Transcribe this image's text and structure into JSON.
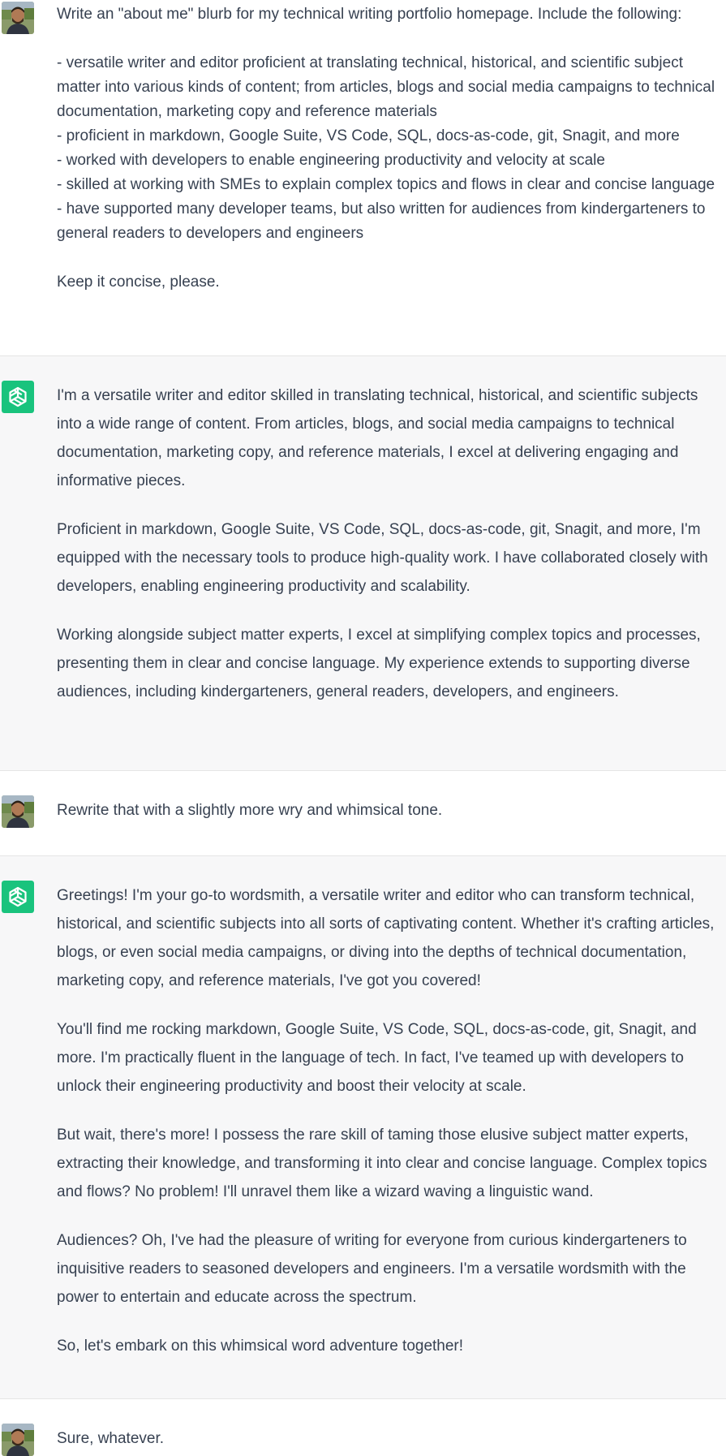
{
  "conversation": {
    "turns": [
      {
        "role": "user",
        "avatar_icon": "user-avatar",
        "paragraphs": [
          "Write an \"about me\" blurb for my technical writing portfolio homepage. Include the following:",
          "- versatile writer and editor proficient at translating technical, historical, and scientific subject matter into various kinds of content; from articles, blogs and social media campaigns to technical documentation, marketing copy and reference materials\n- proficient in markdown, Google Suite, VS Code, SQL, docs-as-code, git, Snagit, and more\n- worked with developers to enable engineering productivity and velocity at scale\n- skilled at working with SMEs to explain complex topics and flows in clear and concise language\n- have supported many developer teams, but also written for audiences from kindergarteners to general readers to developers and engineers",
          "Keep it concise, please."
        ]
      },
      {
        "role": "assistant",
        "avatar_icon": "chatgpt-logo-icon",
        "paragraphs": [
          "I'm a versatile writer and editor skilled in translating technical, historical, and scientific subjects into a wide range of content. From articles, blogs, and social media campaigns to technical documentation, marketing copy, and reference materials, I excel at delivering engaging and informative pieces.",
          "Proficient in markdown, Google Suite, VS Code, SQL, docs-as-code, git, Snagit, and more, I'm equipped with the necessary tools to produce high-quality work. I have collaborated closely with developers, enabling engineering productivity and scalability.",
          "Working alongside subject matter experts, I excel at simplifying complex topics and processes, presenting them in clear and concise language. My experience extends to supporting diverse audiences, including kindergarteners, general readers, developers, and engineers."
        ]
      },
      {
        "role": "user",
        "avatar_icon": "user-avatar",
        "paragraphs": [
          "Rewrite that with a slightly more wry and whimsical tone."
        ]
      },
      {
        "role": "assistant",
        "avatar_icon": "chatgpt-logo-icon",
        "paragraphs": [
          "Greetings! I'm your go-to wordsmith, a versatile writer and editor who can transform technical, historical, and scientific subjects into all sorts of captivating content. Whether it's crafting articles, blogs, or even social media campaigns, or diving into the depths of technical documentation, marketing copy, and reference materials, I've got you covered!",
          "You'll find me rocking markdown, Google Suite, VS Code, SQL, docs-as-code, git, Snagit, and more. I'm practically fluent in the language of tech. In fact, I've teamed up with developers to unlock their engineering productivity and boost their velocity at scale.",
          "But wait, there's more! I possess the rare skill of taming those elusive subject matter experts, extracting their knowledge, and transforming it into clear and concise language. Complex topics and flows? No problem! I'll unravel them like a wizard waving a linguistic wand.",
          "Audiences? Oh, I've had the pleasure of writing for everyone from curious kindergarteners to inquisitive readers to seasoned developers and engineers. I'm a versatile wordsmith with the power to entertain and educate across the spectrum.",
          "So, let's embark on this whimsical word adventure together!"
        ]
      },
      {
        "role": "user",
        "avatar_icon": "user-avatar",
        "paragraphs": [
          "Sure, whatever."
        ]
      }
    ]
  },
  "colors": {
    "user_background": "#ffffff",
    "assistant_background": "#f7f7f8",
    "text": "#374151",
    "divider": "#e5e5e5",
    "assistant_logo_bg": "#19c37d"
  }
}
